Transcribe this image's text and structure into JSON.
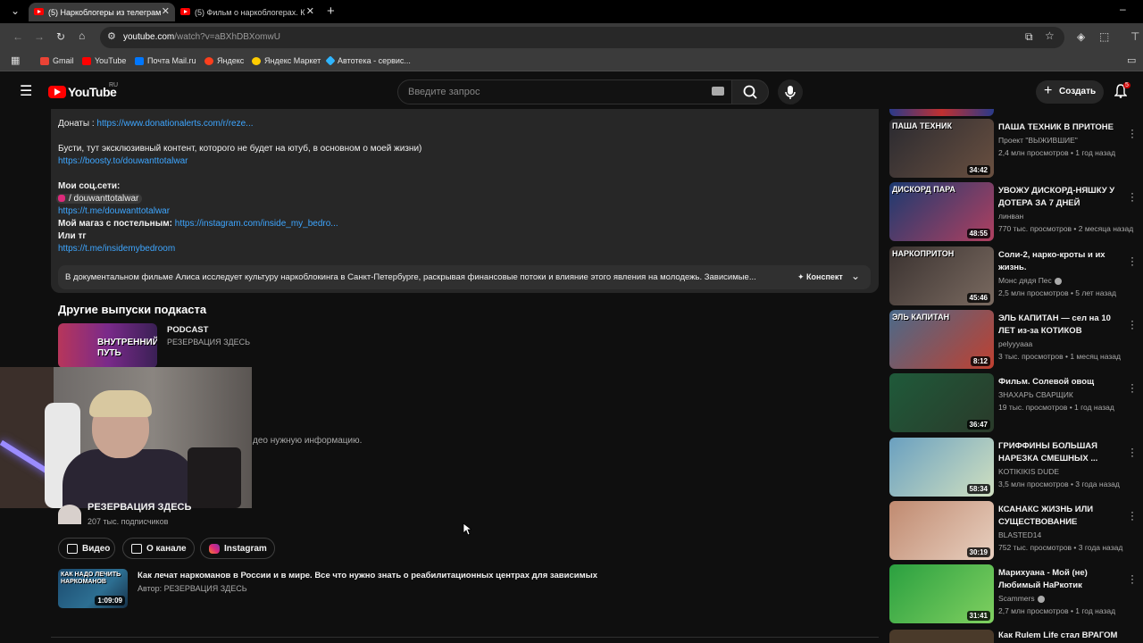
{
  "browser": {
    "tabs": [
      {
        "label": "(5) Наркоблогеры из телеграм"
      },
      {
        "label": "(5) Фильм о наркоблогерах. К"
      }
    ],
    "url_host": "youtube.com",
    "url_path": "/watch?v=aBXhDBXomwU",
    "bookmarks": [
      {
        "label": "Gmail",
        "color": "#ea4335"
      },
      {
        "label": "YouTube",
        "color": "#ff0000"
      },
      {
        "label": "Почта Mail.ru",
        "color": "#0077ff"
      },
      {
        "label": "Яндекс",
        "color": "#fc3f1d"
      },
      {
        "label": "Яндекс Маркет",
        "color": "#ffcc00"
      },
      {
        "label": "Автотека - сервис...",
        "color": "#2fb5ff"
      }
    ]
  },
  "header": {
    "logo": "YouTube",
    "region": "RU",
    "search_placeholder": "Введите запрос",
    "create_label": "Создать",
    "notifications_count": "5"
  },
  "description": {
    "donate_label": "Донаты : ",
    "donate_link": "https://www.donationalerts.com/r/reze...",
    "boosty_text": "Бусти, тут эксклюзивный контент, которого не будет на ютуб, в основном о моей жизни)",
    "boosty_link": "https://boosty.to/douwanttotalwar",
    "socials_label": "Мои соц.сети:",
    "insta_handle": "/ douwanttotalwar",
    "tg_link": "https://t.me/douwanttotalwar",
    "shop_label": "Мой магаз с постельным: ",
    "shop_link": "https://instagram.com/inside_my_bedro...",
    "or_tg": "Или тг",
    "tg2_link": "https://t.me/insidemybedroom",
    "summary": "В документальном фильме Алиса исследует культуру наркоблокинга в Санкт-Петербурге, раскрывая финансовые потоки и влияние этого явления на молодежь. Зависимые...",
    "konspekt": "Конспект"
  },
  "podcast": {
    "heading": "Другие выпуски подкаста",
    "thumb_text": "ВНУТРЕННИЙ ПУТЬ",
    "title": "PODCAST",
    "subtitle": "РЕЗЕРВАЦИЯ ЗДЕСЬ"
  },
  "overlap_text": "део нужную информацию.",
  "channel": {
    "name": "РЕЗЕРВАЦИЯ ЗДЕСЬ",
    "subs": "207 тыс. подписчиков",
    "pills": [
      "Видео",
      "О канале",
      "Instagram"
    ]
  },
  "channel_video": {
    "thumb_text": "КАК НАДО ЛЕЧИТЬ НАРКОМАНОВ",
    "duration": "1:09:09",
    "title": "Как лечат наркоманов в России и в мире. Все что нужно знать о реабилитационных центрах для зависимых",
    "author": "Автор: РЕЗЕРВАЦИЯ ЗДЕСЬ"
  },
  "sidebar": [
    {
      "title": "ПАША ТЕХНИК В ПРИТОНЕ",
      "channel": "Проект \"ВЫЖИВШИЕ\"",
      "meta": "2,4 млн просмотров • 1 год назад",
      "duration": "34:42",
      "caption": "ПАША ТЕХНИК",
      "colors": [
        "#2a2a30",
        "#6a5040"
      ],
      "verified": false
    },
    {
      "title": "УВОЖУ ДИСКОРД-НЯШКУ У ДОТЕРА ЗА 7 ДНЕЙ",
      "channel": "линван",
      "meta": "770 тыс. просмотров • 2 месяца назад",
      "duration": "48:55",
      "caption": "ДИСКОРД ПАРА",
      "colors": [
        "#1c3a70",
        "#b04060"
      ],
      "verified": false
    },
    {
      "title": "Соли-2, нарко-кроты и их жизнь.",
      "channel": "Монс дядя Пес",
      "meta": "2,5 млн просмотров • 5 лет назад",
      "duration": "45:46",
      "caption": "НАРКОПРИТОН",
      "colors": [
        "#3a3230",
        "#7a6a60"
      ],
      "verified": true
    },
    {
      "title": "ЭЛЬ КАПИТАН — сел на 10 ЛЕТ из-за КОТИКОВ",
      "channel": "pelyyyaaa",
      "meta": "3 тыс. просмотров • 1 месяц назад",
      "duration": "8:12",
      "caption": "ЭЛЬ КАПИТАН",
      "colors": [
        "#4a6a8a",
        "#c04030"
      ],
      "verified": false
    },
    {
      "title": "Фильм. Солевой овощ",
      "channel": "ЗНАХАРЬ СВАРЩИК",
      "meta": "19 тыс. просмотров • 1 год назад",
      "duration": "36:47",
      "caption": "",
      "colors": [
        "#1f5a3a",
        "#2a3a2a"
      ],
      "verified": false
    },
    {
      "title": "ГРИФФИНЫ БОЛЬШАЯ НАРЕЗКА СМЕШНЫХ ...",
      "channel": "KOTIKIKIS DUDE",
      "meta": "3,5 млн просмотров • 3 года назад",
      "duration": "58:34",
      "caption": "",
      "colors": [
        "#6aa0c0",
        "#d0e0c0"
      ],
      "verified": false
    },
    {
      "title": "КСАНАКС  ЖИЗНЬ ИЛИ СУЩЕСТВОВАНИЕ",
      "channel": "BLASTED14",
      "meta": "752 тыс. просмотров • 3 года назад",
      "duration": "30:19",
      "caption": "",
      "colors": [
        "#c08a70",
        "#e8d0c0"
      ],
      "verified": false
    },
    {
      "title": "Марихуана - Мой (не) Любимый НаРкотик",
      "channel": "Scammers",
      "meta": "2,7 млн просмотров • 1 год назад",
      "duration": "31:41",
      "caption": "",
      "colors": [
        "#2aa040",
        "#80d060"
      ],
      "verified": true
    }
  ],
  "sidebar_last_title": "Как Rulem Life стал ВРАГОМ"
}
